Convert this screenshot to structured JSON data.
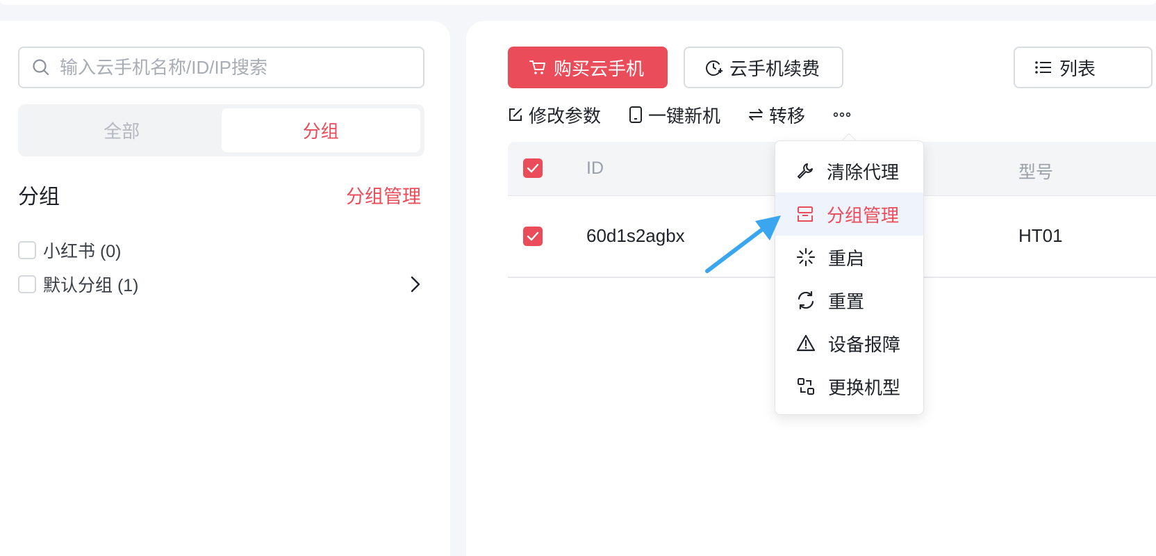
{
  "sidebar": {
    "search": {
      "placeholder": "输入云手机名称/ID/IP搜索"
    },
    "tabs": [
      {
        "label": "全部"
      },
      {
        "label": "分组"
      }
    ],
    "active_tab": "分组",
    "group_title": "分组",
    "group_manage": "分组管理",
    "groups": [
      {
        "label": "小红书 (0)"
      },
      {
        "label": "默认分组 (1)"
      }
    ]
  },
  "toolbar": {
    "buy_label": "购买云手机",
    "renew_label": "云手机续费",
    "list_label": "列表",
    "actions": [
      {
        "label": "修改参数"
      },
      {
        "label": "一键新机"
      },
      {
        "label": "转移"
      }
    ],
    "more_label": "•••"
  },
  "table": {
    "columns": [
      "ID",
      "型号"
    ],
    "rows": [
      {
        "id": "60d1s2agbx",
        "model": "HT01"
      }
    ]
  },
  "dropdown": {
    "items": [
      {
        "label": "清除代理",
        "icon": "wrench-icon"
      },
      {
        "label": "分组管理",
        "icon": "group-icon"
      },
      {
        "label": "重启",
        "icon": "loading-icon"
      },
      {
        "label": "重置",
        "icon": "refresh-icon"
      },
      {
        "label": "设备报障",
        "icon": "warning-icon"
      },
      {
        "label": "更换机型",
        "icon": "swap-model-icon"
      }
    ],
    "active": "分组管理"
  },
  "colors": {
    "accent": "#ea4c5a",
    "arrow": "#3aa6f0",
    "menu_active_bg": "#eef3fc"
  }
}
